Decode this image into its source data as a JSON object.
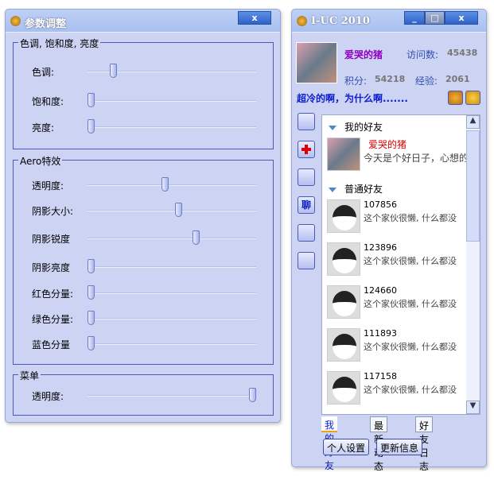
{
  "params": {
    "title": "参数调整",
    "close": "x",
    "groups": [
      {
        "label": "色调, 饱和度, 亮度",
        "sliders": [
          {
            "label": "色调:",
            "value": 0.14
          },
          {
            "label": "饱和度:",
            "value": 0
          },
          {
            "label": "亮度:",
            "value": 0
          }
        ]
      },
      {
        "label": "Aero特效",
        "sliders": [
          {
            "label": "透明度:",
            "value": 0.46
          },
          {
            "label": "阴影大小:",
            "value": 0.54
          },
          {
            "label": "阴影锐度",
            "value": 0.65
          },
          {
            "label": "阴影亮度",
            "value": 0
          },
          {
            "label": "红色分量:",
            "value": 0
          },
          {
            "label": "绿色分量:",
            "value": 0
          },
          {
            "label": "蓝色分量",
            "value": 0
          }
        ]
      },
      {
        "label": "菜单",
        "sliders": [
          {
            "label": "透明度:",
            "value": 1
          }
        ]
      }
    ]
  },
  "iuc": {
    "title": "I-UC 2010",
    "min": "_",
    "close": "x",
    "username": "爱哭的猪",
    "visits_label": "访问数:",
    "visits": "45438",
    "points_label": "积分:",
    "points": "54218",
    "exp_label": "经验:",
    "exp": "2061",
    "status": "超冷的啊，为什么啊.......",
    "side_buttons": [
      "",
      "",
      "",
      "聊",
      "",
      ""
    ],
    "cat1": "我的好友",
    "cat2": "普通好友",
    "me": {
      "name": "爱哭的猪",
      "sig": "今天是个好日子，心想的"
    },
    "friends": [
      {
        "id": "107856",
        "sig": "这个家伙很懒, 什么都没"
      },
      {
        "id": "123896",
        "sig": "这个家伙很懒, 什么都没"
      },
      {
        "id": "124660",
        "sig": "这个家伙很懒, 什么都没"
      },
      {
        "id": "111893",
        "sig": "这个家伙很懒, 什么都没"
      },
      {
        "id": "117158",
        "sig": "这个家伙很懒, 什么都没"
      }
    ],
    "tabs": [
      "我的好友",
      "最新动态",
      "好友日志"
    ],
    "buttons": [
      "个人设置",
      "更新信息"
    ]
  }
}
